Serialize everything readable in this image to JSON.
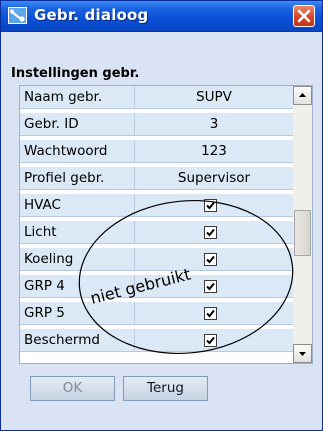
{
  "window": {
    "title": "Gebr. dialoog",
    "icon": "user-tool-icon",
    "close_icon": "close-icon"
  },
  "section": {
    "title": "Instellingen gebr."
  },
  "settings": {
    "rows": [
      {
        "label": "Naam gebr.",
        "value": "SUPV"
      },
      {
        "label": "Gebr. ID",
        "value": "3"
      },
      {
        "label": "Wachtwoord",
        "value": "123"
      },
      {
        "label": "Profiel gebr.",
        "value": "Supervisor"
      },
      {
        "label": "HVAC",
        "checked": true
      },
      {
        "label": "Licht",
        "checked": true
      },
      {
        "label": "Koeling",
        "checked": true
      },
      {
        "label": "GRP 4",
        "checked": true
      },
      {
        "label": "GRP 5",
        "checked": true
      },
      {
        "label": "Beschermd",
        "checked": true
      }
    ]
  },
  "annotation": {
    "text": "niet gebruikt"
  },
  "buttons": {
    "ok_label": "OK",
    "back_label": "Terug"
  },
  "colors": {
    "titlebar": "#0a4fd6",
    "window_bg": "#d9e3f3",
    "row_bg": "#dbe8f5",
    "close": "#d5452a"
  }
}
